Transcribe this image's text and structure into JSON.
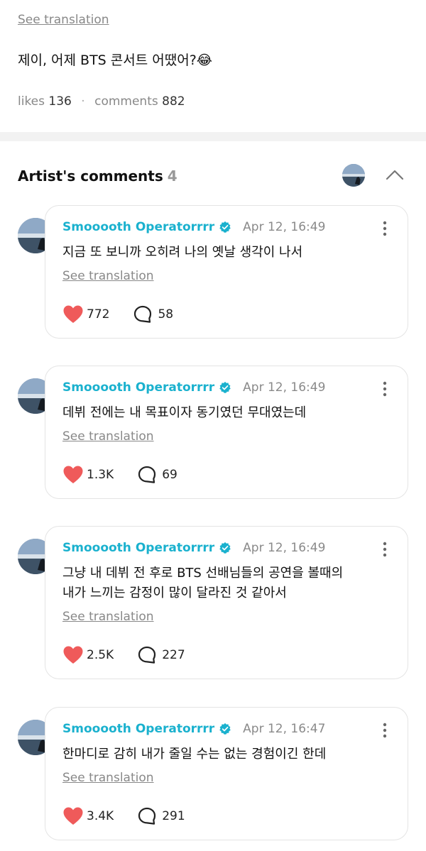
{
  "post": {
    "see_translation": "See translation",
    "text": "제이, 어제 BTS 콘서트 어땠어?😂",
    "likes_label": "likes",
    "likes_count": "136",
    "comments_label": "comments",
    "comments_count": "882"
  },
  "section": {
    "title": "Artist's comments",
    "count": "4"
  },
  "colors": {
    "accent": "#1ab1ce",
    "heart": "#ef5a5a",
    "muted": "#888888"
  },
  "comments": [
    {
      "name": "Smooooth Operatorrrr",
      "time": "Apr 12, 16:49",
      "text_lines": [
        "지금 또 보니까 오히려 나의 옛날 생각이 나서"
      ],
      "see_translation": "See translation",
      "likes": "772",
      "replies": "58"
    },
    {
      "name": "Smooooth Operatorrrr",
      "time": "Apr 12, 16:49",
      "text_lines": [
        "데뷔 전에는 내 목표이자 동기였던 무대였는데"
      ],
      "see_translation": "See translation",
      "likes": "1.3K",
      "replies": "69"
    },
    {
      "name": "Smooooth Operatorrrr",
      "time": "Apr 12, 16:49",
      "text_lines": [
        "그냥 내 데뷔 전 후로 BTS 선배님들의 공연을 볼때의",
        "내가 느끼는 감정이 많이 달라진 것 같아서"
      ],
      "see_translation": "See translation",
      "likes": "2.5K",
      "replies": "227"
    },
    {
      "name": "Smooooth Operatorrrr",
      "time": "Apr 12, 16:47",
      "text_lines": [
        "한마디로 감히 내가 줄일 수는 없는 경험이긴 한데"
      ],
      "see_translation": "See translation",
      "likes": "3.4K",
      "replies": "291"
    }
  ]
}
